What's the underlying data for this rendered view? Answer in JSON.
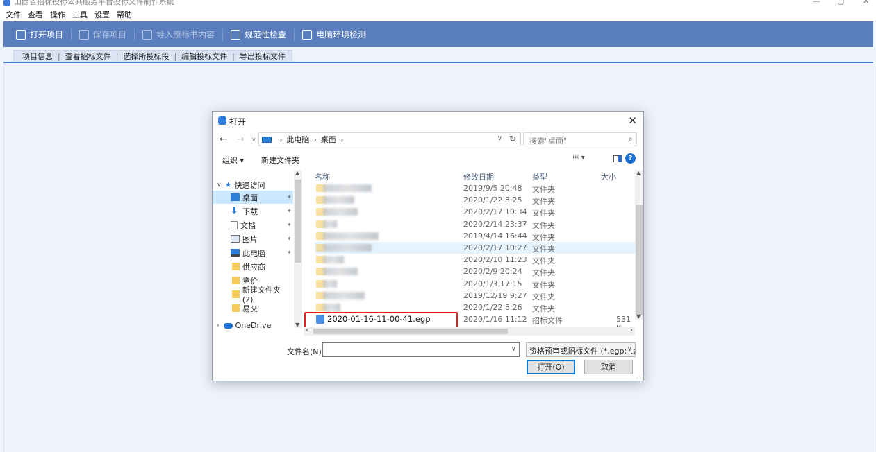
{
  "window": {
    "title": "山西省招标投标公共服务平台投标文件制作系统",
    "controls": [
      "—",
      "▢",
      "✕"
    ]
  },
  "menu": [
    "文件",
    "查看",
    "操作",
    "工具",
    "设置",
    "帮助"
  ],
  "toolbar": [
    {
      "label": "打开项目",
      "enabled": true
    },
    {
      "label": "保存项目",
      "enabled": false
    },
    {
      "label": "导入原标书内容",
      "enabled": false
    },
    {
      "label": "规范性检查",
      "enabled": true
    },
    {
      "label": "电脑环境检测",
      "enabled": true
    }
  ],
  "nav_tabs": [
    "项目信息",
    "查看招标文件",
    "选择所投标段",
    "编辑投标文件",
    "导出投标文件"
  ],
  "nav_sep": "|",
  "dialog": {
    "title": "打开",
    "close": "✕",
    "back": "←",
    "forward": "→",
    "recent": "∨",
    "path": [
      "此电脑",
      "桌面"
    ],
    "path_sep": "›",
    "search_placeholder": "搜索\"桌面\"",
    "organize": "组织 ▾",
    "new_folder": "新建文件夹",
    "view_icon": "⁞⁞⁞ ▾",
    "help": "?",
    "nav_items": [
      {
        "label": "快速访问",
        "icon": "star-icon"
      },
      {
        "label": "桌面",
        "icon": "desktop-icon",
        "pinned": true
      },
      {
        "label": "下载",
        "icon": "download-icon",
        "pinned": true
      },
      {
        "label": "文档",
        "icon": "document-icon",
        "pinned": true
      },
      {
        "label": "图片",
        "icon": "picture-icon",
        "pinned": true
      },
      {
        "label": "此电脑",
        "icon": "computer-icon",
        "pinned": true
      },
      {
        "label": "供应商",
        "icon": "folder-icon"
      },
      {
        "label": "竞价",
        "icon": "folder-icon"
      },
      {
        "label": "新建文件夹 (2)",
        "icon": "folder-icon"
      },
      {
        "label": "易交",
        "icon": "folder-icon"
      },
      {
        "label": "OneDrive",
        "icon": "cloud-icon"
      }
    ],
    "columns": [
      "名称",
      "修改日期",
      "类型",
      "大小"
    ],
    "files": [
      {
        "modified": "2019/9/5 20:48",
        "type": "文件夹",
        "size": ""
      },
      {
        "modified": "2020/1/22 8:25",
        "type": "文件夹",
        "size": ""
      },
      {
        "modified": "2020/2/17 10:34",
        "type": "文件夹",
        "size": ""
      },
      {
        "modified": "2020/2/14 23:37",
        "type": "文件夹",
        "size": ""
      },
      {
        "modified": "2019/4/14 16:44",
        "type": "文件夹",
        "size": ""
      },
      {
        "modified": "2020/2/17 10:27",
        "type": "文件夹",
        "size": ""
      },
      {
        "modified": "2020/2/10 11:23",
        "type": "文件夹",
        "size": ""
      },
      {
        "modified": "2020/2/9 20:24",
        "type": "文件夹",
        "size": ""
      },
      {
        "modified": "2020/1/3 17:15",
        "type": "文件夹",
        "size": ""
      },
      {
        "modified": "2019/12/19 9:27",
        "type": "文件夹",
        "size": ""
      },
      {
        "modified": "2020/1/22 8:26",
        "type": "文件夹",
        "size": ""
      }
    ],
    "highlighted_file": {
      "name": "2020-01-16-11-00-41.egp",
      "modified": "2020/1/16 11:12",
      "type": "招标文件",
      "size": "531 K"
    },
    "filename_label": "文件名(N):",
    "filename_value": "",
    "filter": "资格预审或招标文件 (*.egp;*.z",
    "open_button": "打开(O)",
    "cancel_button": "取消"
  },
  "colors": {
    "toolbar": "#5a7ebd",
    "accent": "#4a7fd0",
    "highlight_box": "#e02020"
  }
}
